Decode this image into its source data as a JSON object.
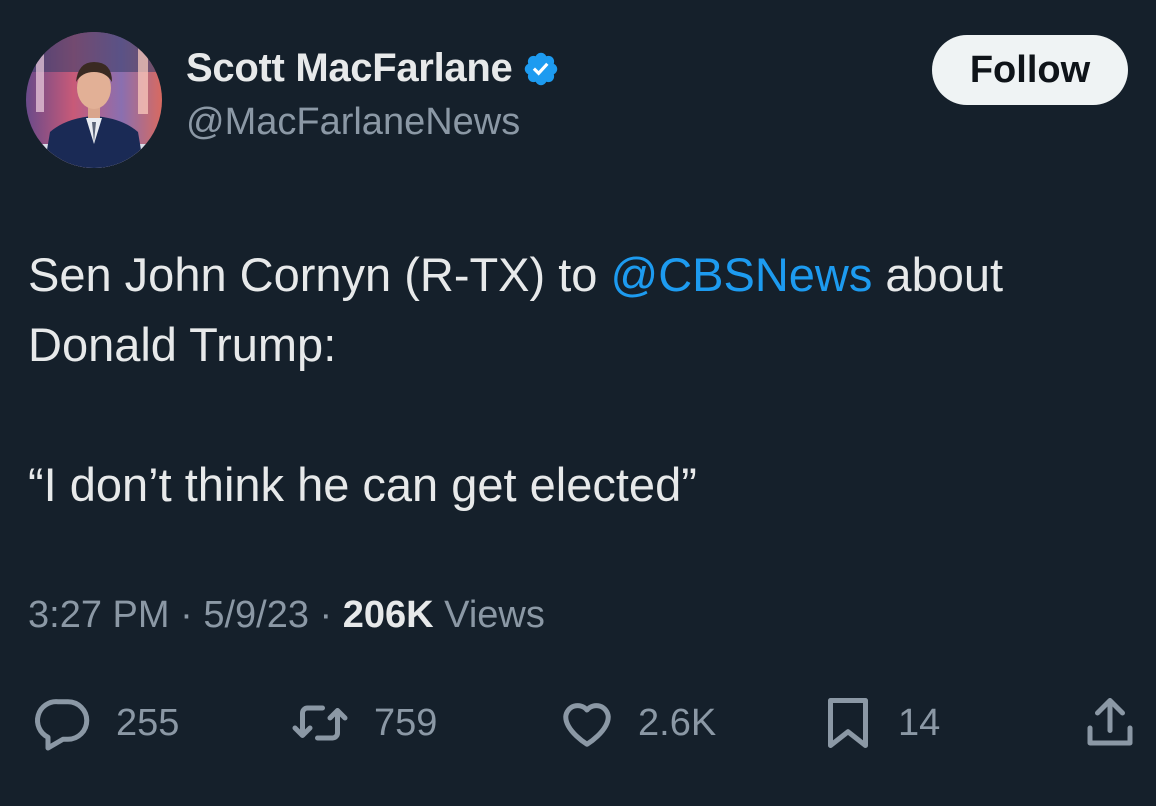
{
  "author": {
    "display_name": "Scott MacFarlane",
    "handle": "@MacFarlaneNews",
    "verified": true
  },
  "follow_button": {
    "label": "Follow"
  },
  "tweet": {
    "text_before": "Sen John Cornyn (R-TX) to ",
    "mention": "@CBSNews",
    "text_after": " about Donald Trump:",
    "quote": "“I don’t think he can get elected”"
  },
  "meta": {
    "time": "3:27 PM",
    "date": "5/9/23",
    "views_count": "206K",
    "views_label": "Views",
    "separator": "·"
  },
  "actions": {
    "replies": "255",
    "retweets": "759",
    "likes": "2.6K",
    "bookmarks": "14"
  },
  "colors": {
    "background": "#15202b",
    "primary_text": "#e7e9ea",
    "secondary_text": "#8b98a5",
    "accent": "#1d9bf0",
    "verified_badge": "#1d9bf0"
  },
  "icons": {
    "verified": "verified-badge-icon",
    "reply": "reply-icon",
    "retweet": "retweet-icon",
    "like": "heart-icon",
    "bookmark": "bookmark-icon",
    "share": "share-icon"
  }
}
